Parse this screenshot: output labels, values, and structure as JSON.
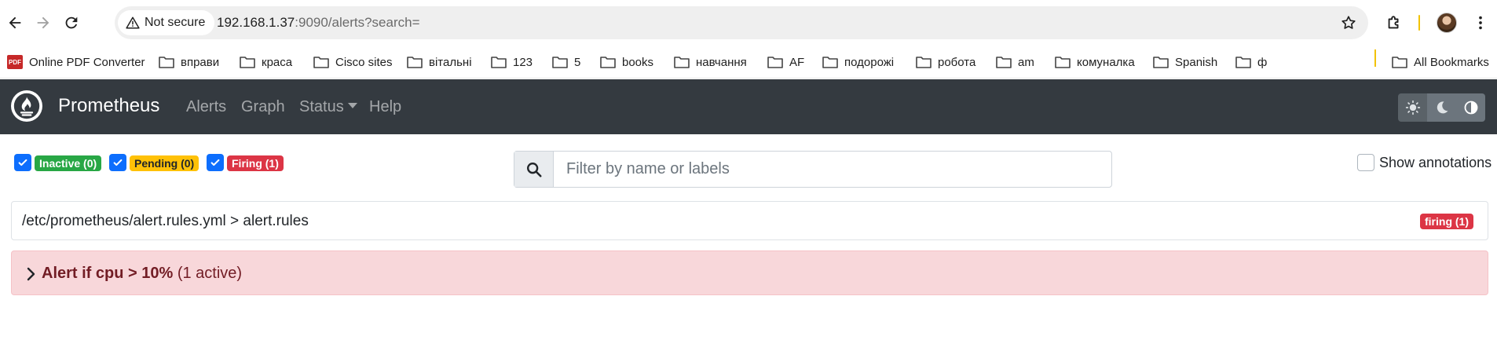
{
  "browser": {
    "security_label": "Not secure",
    "url_host": "192.168.1.37",
    "url_rest": ":9090/alerts?search=",
    "bookmarks": [
      {
        "label": "Online PDF Converter",
        "icon": "pdf-icon"
      },
      {
        "label": "вправи",
        "icon": "folder-icon"
      },
      {
        "label": "краса",
        "icon": "folder-icon"
      },
      {
        "label": "Cisco sites",
        "icon": "folder-icon"
      },
      {
        "label": "вітальні",
        "icon": "folder-icon"
      },
      {
        "label": "123",
        "icon": "folder-icon"
      },
      {
        "label": "5",
        "icon": "folder-icon"
      },
      {
        "label": "books",
        "icon": "folder-icon"
      },
      {
        "label": "навчання",
        "icon": "folder-icon"
      },
      {
        "label": "AF",
        "icon": "folder-icon"
      },
      {
        "label": "подорожі",
        "icon": "folder-icon"
      },
      {
        "label": "робота",
        "icon": "folder-icon"
      },
      {
        "label": "am",
        "icon": "folder-icon"
      },
      {
        "label": "комуналка",
        "icon": "folder-icon"
      },
      {
        "label": "Spanish",
        "icon": "folder-icon"
      },
      {
        "label": "ф",
        "icon": "folder-icon"
      }
    ],
    "all_bookmarks": "All Bookmarks"
  },
  "navbar": {
    "brand": "Prometheus",
    "links": {
      "alerts": "Alerts",
      "graph": "Graph",
      "status": "Status",
      "help": "Help"
    }
  },
  "filters": {
    "inactive": "Inactive (0)",
    "pending": "Pending (0)",
    "firing": "Firing (1)",
    "inactive_checked": true,
    "pending_checked": true,
    "firing_checked": true,
    "search_placeholder": "Filter by name or labels",
    "search_value": "",
    "show_annotations": "Show annotations",
    "show_annotations_checked": false
  },
  "rule_group": {
    "path": "/etc/prometheus/alert.rules.yml > alert.rules",
    "state_badge": "firing (1)",
    "alert": {
      "name": "Alert if cpu > 10%",
      "active": "(1 active)"
    }
  },
  "colors": {
    "navbar": "#343a40",
    "inactive": "#28a745",
    "pending": "#ffc107",
    "firing": "#dc3545",
    "alert_bg": "#f8d7da",
    "alert_text": "#721c24"
  }
}
